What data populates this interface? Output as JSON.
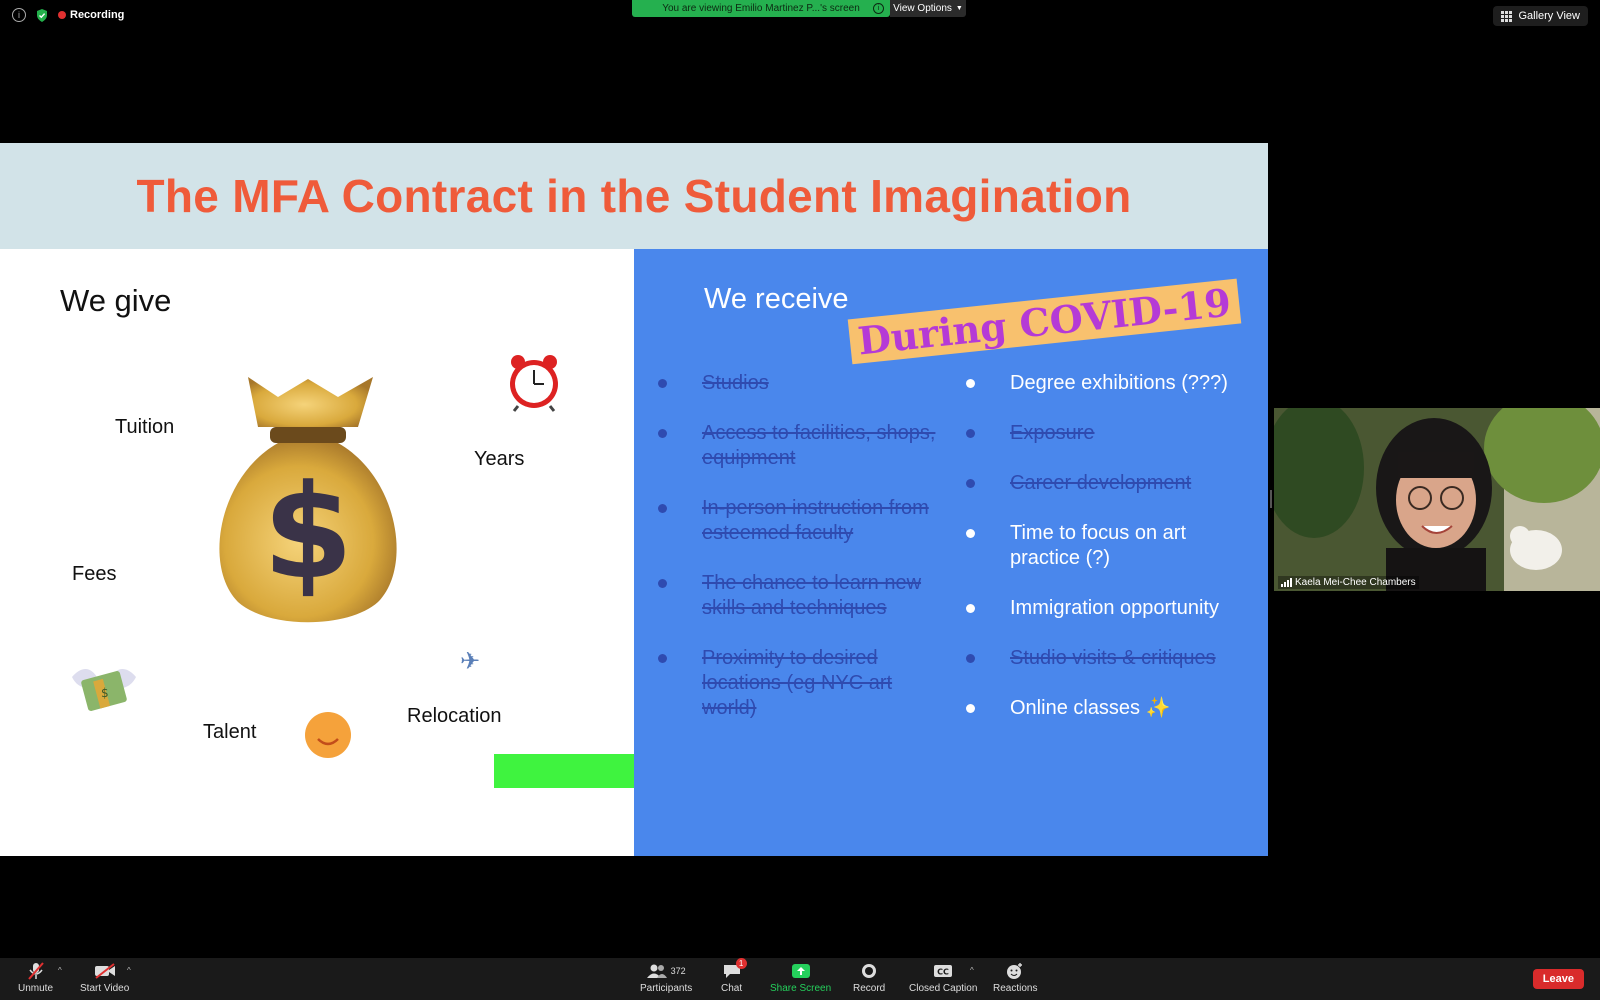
{
  "top_bar": {
    "recording_label": "Recording",
    "viewing_banner": "You are viewing Emilio Martinez P...'s screen",
    "view_options_label": "View Options",
    "gallery_view_label": "Gallery View"
  },
  "slide": {
    "title": "The MFA Contract in the Student Imagination",
    "left": {
      "heading": "We give",
      "labels": {
        "tuition": "Tuition",
        "years": "Years",
        "fees": "Fees",
        "talent": "Talent",
        "relocation": "Relocation"
      },
      "icons": [
        "money-bag-icon",
        "alarm-clock-icon",
        "money-with-wings-icon",
        "smiley-icon",
        "airplane-icon",
        "arrow-right-icon"
      ]
    },
    "right": {
      "heading": "We receive",
      "overlay": "During COVID-19",
      "left_items": [
        {
          "text": "Studios",
          "struck": true
        },
        {
          "text": "Access to facilities, shops, equipment",
          "struck": true
        },
        {
          "text": "In-person instruction from esteemed faculty",
          "struck": true
        },
        {
          "text": "The chance to learn new skills and techniques",
          "struck": true
        },
        {
          "text": "Proximity to desired locations (eg NYC art world)",
          "struck": true
        }
      ],
      "right_items": [
        {
          "text": "Degree exhibitions (???)",
          "struck": false
        },
        {
          "text": "Exposure",
          "struck": true
        },
        {
          "text": "Career development",
          "struck": true
        },
        {
          "text": "Time to focus on art practice (?)",
          "struck": false
        },
        {
          "text": "Immigration opportunity",
          "struck": false
        },
        {
          "text": "Studio visits & critiques",
          "struck": true
        },
        {
          "text": "Online classes ✨",
          "struck": false
        }
      ]
    }
  },
  "participant_tile": {
    "name": "Kaela Mei-Chee Chambers"
  },
  "toolbar": {
    "unmute": "Unmute",
    "start_video": "Start Video",
    "participants": "Participants",
    "participant_count": "372",
    "chat": "Chat",
    "chat_badge": "1",
    "share_screen": "Share Screen",
    "record": "Record",
    "closed_caption": "Closed Caption",
    "reactions": "Reactions",
    "leave": "Leave"
  },
  "colors": {
    "title_orange": "#ef5b3a",
    "right_pane_blue": "#4a87ec",
    "struck_text": "#2f4bb0",
    "covid_text": "#b53ad6",
    "covid_bg": "#f8c16e",
    "banner_green": "#25b04f",
    "leave_red": "#d92b2b"
  }
}
